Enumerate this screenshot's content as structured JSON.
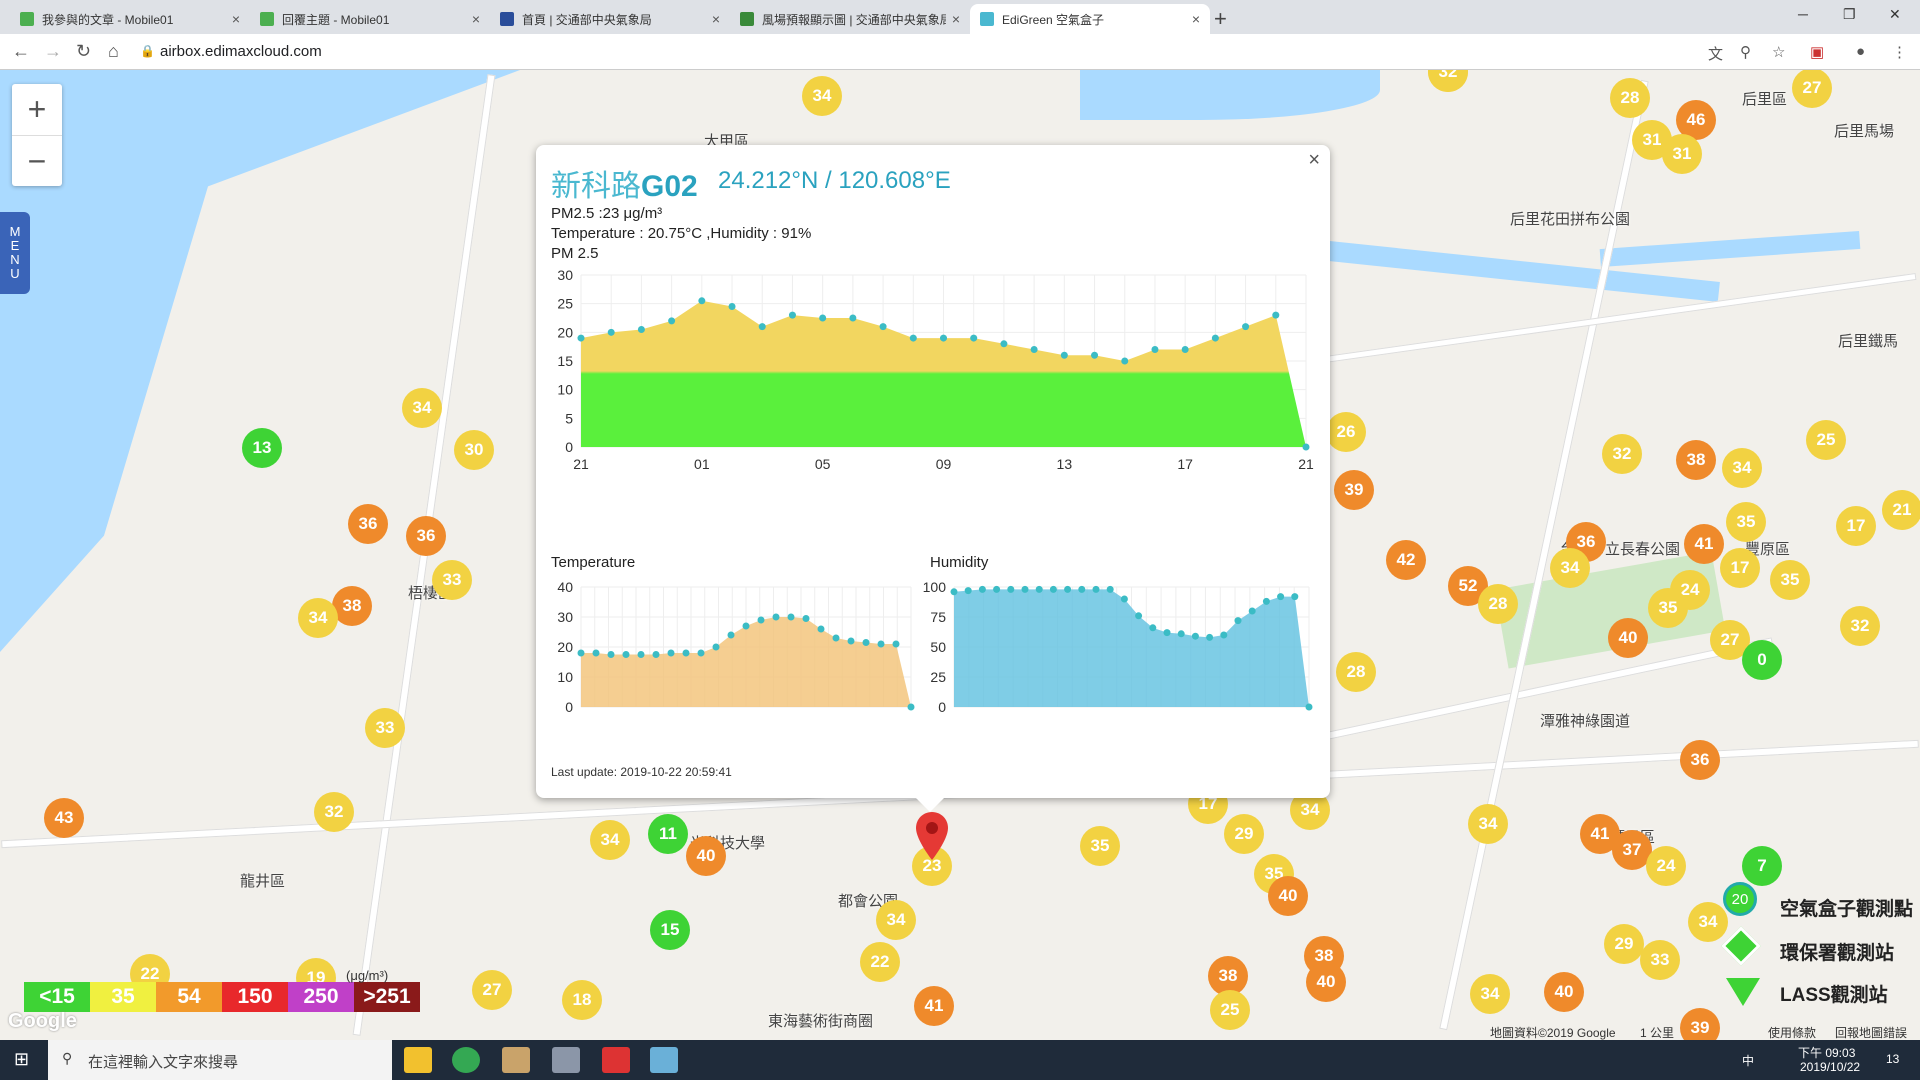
{
  "browser": {
    "tabs": [
      {
        "title": "我參與的文章 - Mobile01",
        "color": "#4caf50"
      },
      {
        "title": "回覆主題 - Mobile01",
        "color": "#4caf50"
      },
      {
        "title": "首頁 | 交通部中央氣象局",
        "color": "#2a4d9a"
      },
      {
        "title": "風場預報顯示圖 | 交通部中央氣象局",
        "color": "#3a8a3a"
      },
      {
        "title": "EdiGreen 空氣盒子",
        "color": "#4ab8d0"
      }
    ],
    "active_tab": 4,
    "url": "airbox.edimaxcloud.com",
    "new_tab": "+",
    "close_glyph": "×"
  },
  "map": {
    "zoom_in": "+",
    "zoom_out": "−",
    "menu": [
      "M",
      "E",
      "N",
      "U"
    ],
    "labels": [
      "梧棲區",
      "龍井區",
      "后里區",
      "后里馬場",
      "后里花田拼布公園",
      "都會公園",
      "東海藝術街商圈",
      "台中市立長春公園",
      "潭雅神綠園道",
      "豐原區",
      "潭子區",
      "大甲區",
      "光科技大學",
      "北區",
      "后里鐵馬"
    ],
    "markers": [
      {
        "v": "34",
        "c": "y"
      },
      {
        "v": "33",
        "c": "y"
      },
      {
        "v": "32",
        "c": "y"
      },
      {
        "v": "28",
        "c": "y"
      },
      {
        "v": "27",
        "c": "y"
      },
      {
        "v": "46",
        "c": "o"
      },
      {
        "v": "31",
        "c": "y"
      },
      {
        "v": "31",
        "c": "y"
      },
      {
        "v": "13",
        "c": "g"
      },
      {
        "v": "34",
        "c": "y"
      },
      {
        "v": "30",
        "c": "y"
      },
      {
        "v": "36",
        "c": "o"
      },
      {
        "v": "36",
        "c": "o"
      },
      {
        "v": "33",
        "c": "y"
      },
      {
        "v": "38",
        "c": "o"
      },
      {
        "v": "34",
        "c": "y"
      },
      {
        "v": "33",
        "c": "y"
      },
      {
        "v": "43",
        "c": "o"
      },
      {
        "v": "32",
        "c": "y"
      },
      {
        "v": "34",
        "c": "y"
      },
      {
        "v": "11",
        "c": "g"
      },
      {
        "v": "40",
        "c": "o"
      },
      {
        "v": "15",
        "c": "g"
      },
      {
        "v": "23",
        "c": "y"
      },
      {
        "v": "34",
        "c": "y"
      },
      {
        "v": "22",
        "c": "y"
      },
      {
        "v": "41",
        "c": "o"
      },
      {
        "v": "18",
        "c": "y"
      },
      {
        "v": "27",
        "c": "y"
      },
      {
        "v": "35",
        "c": "y"
      },
      {
        "v": "17",
        "c": "y"
      },
      {
        "v": "29",
        "c": "y"
      },
      {
        "v": "34",
        "c": "y"
      },
      {
        "v": "35",
        "c": "y"
      },
      {
        "v": "40",
        "c": "o"
      },
      {
        "v": "38",
        "c": "o"
      },
      {
        "v": "25",
        "c": "y"
      },
      {
        "v": "38",
        "c": "o"
      },
      {
        "v": "40",
        "c": "o"
      },
      {
        "v": "26",
        "c": "y"
      },
      {
        "v": "39",
        "c": "o"
      },
      {
        "v": "28",
        "c": "y"
      },
      {
        "v": "42",
        "c": "o"
      },
      {
        "v": "52",
        "c": "o"
      },
      {
        "v": "28",
        "c": "y"
      },
      {
        "v": "36",
        "c": "o"
      },
      {
        "v": "34",
        "c": "y"
      },
      {
        "v": "32",
        "c": "y"
      },
      {
        "v": "38",
        "c": "o"
      },
      {
        "v": "34",
        "c": "y"
      },
      {
        "v": "41",
        "c": "o"
      },
      {
        "v": "35",
        "c": "y"
      },
      {
        "v": "17",
        "c": "y"
      },
      {
        "v": "24",
        "c": "y"
      },
      {
        "v": "35",
        "c": "y"
      },
      {
        "v": "35",
        "c": "y"
      },
      {
        "v": "25",
        "c": "y"
      },
      {
        "v": "17",
        "c": "y"
      },
      {
        "v": "21",
        "c": "y"
      },
      {
        "v": "40",
        "c": "o"
      },
      {
        "v": "27",
        "c": "y"
      },
      {
        "v": "32",
        "c": "y"
      },
      {
        "v": "0",
        "c": "g"
      },
      {
        "v": "36",
        "c": "o"
      },
      {
        "v": "34",
        "c": "y"
      },
      {
        "v": "41",
        "c": "o"
      },
      {
        "v": "37",
        "c": "o"
      },
      {
        "v": "24",
        "c": "y"
      },
      {
        "v": "7",
        "c": "g"
      },
      {
        "v": "29",
        "c": "y"
      },
      {
        "v": "34",
        "c": "y"
      },
      {
        "v": "40",
        "c": "o"
      },
      {
        "v": "39",
        "c": "o"
      },
      {
        "v": "33",
        "c": "y"
      },
      {
        "v": "19",
        "c": "y"
      },
      {
        "v": "22",
        "c": "y"
      },
      {
        "v": "34",
        "c": "y"
      }
    ]
  },
  "popup": {
    "name_prefix": "新科路",
    "name_code": "G02",
    "coords": "24.212°N / 120.608°E",
    "pm_line": "PM2.5 :23 μg/m³",
    "temp_line": "Temperature : 20.75°C ,Humidity : 91%",
    "pm_title": "PM 2.5",
    "temp_title": "Temperature",
    "hum_title": "Humidity",
    "last_update": "Last update: 2019-10-22 20:59:41",
    "close": "×"
  },
  "chart_data": [
    {
      "type": "area",
      "title": "PM 2.5",
      "x_ticks": [
        "21",
        "01",
        "05",
        "09",
        "13",
        "17",
        "21"
      ],
      "ylim": [
        0,
        30
      ],
      "y_ticks": [
        0,
        5,
        10,
        15,
        20,
        25,
        30
      ],
      "values": [
        19,
        20,
        20.5,
        22,
        25.5,
        24.5,
        21,
        23,
        22.5,
        22.5,
        21,
        19,
        19,
        19,
        18,
        17,
        16,
        16,
        15,
        17,
        17,
        19,
        21,
        23,
        0
      ],
      "colors": {
        "low": "#5af03c",
        "high": "#f2d660"
      },
      "threshold": 15
    },
    {
      "type": "area",
      "title": "Temperature",
      "ylim": [
        0,
        40
      ],
      "y_ticks": [
        0,
        10,
        20,
        30,
        40
      ],
      "values": [
        18,
        18,
        17.5,
        17.5,
        17.5,
        17.5,
        18,
        18,
        18,
        20,
        24,
        27,
        29,
        30,
        30,
        29.5,
        26,
        23,
        22,
        21.5,
        21,
        21,
        0
      ],
      "color": "#f2c276"
    },
    {
      "type": "area",
      "title": "Humidity",
      "ylim": [
        0,
        100
      ],
      "y_ticks": [
        0,
        25,
        50,
        75,
        100
      ],
      "values": [
        96,
        97,
        98,
        98,
        98,
        98,
        98,
        98,
        98,
        98,
        98,
        98,
        90,
        76,
        66,
        62,
        61,
        59,
        58,
        60,
        72,
        80,
        88,
        92,
        92,
        0
      ],
      "color": "#5fc0e0"
    }
  ],
  "legend": {
    "items": [
      {
        "label": "<15",
        "color": "#3ed335"
      },
      {
        "label": "35",
        "color": "#f0f040"
      },
      {
        "label": "54",
        "color": "#f29a2b"
      },
      {
        "label": "150",
        "color": "#e8282b"
      },
      {
        "label": "250",
        "color": "#c040c8"
      },
      {
        "label": ">251",
        "color": "#8a1a1a"
      }
    ],
    "unit": "(μg/m³)"
  },
  "station_legend": {
    "items": [
      "空氣盒子觀測點",
      "環保署觀測站",
      "LASS觀測站"
    ],
    "value": "20"
  },
  "attribution": {
    "data": "地圖資料©2019 Google",
    "scale": "1 公里",
    "terms": "使用條款",
    "report": "回報地圖錯誤",
    "google": "Google"
  },
  "taskbar": {
    "search": "在這裡輸入文字來搜尋",
    "time": "下午 09:03",
    "date": "2019/10/22",
    "ime": "中",
    "notif": "13"
  }
}
